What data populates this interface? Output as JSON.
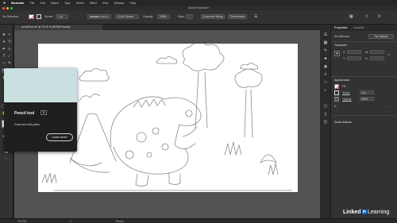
{
  "menubar": {
    "app_name": "Illustrator",
    "items": [
      "File",
      "Edit",
      "Object",
      "Type",
      "Select",
      "Effect",
      "View",
      "Window",
      "Help"
    ]
  },
  "window": {
    "title": "Adobe Illustrator"
  },
  "control_bar": {
    "selection_label": "No Selection",
    "stroke_label": "Stroke:",
    "stroke_value": "1 pt",
    "uniform_label": "Uniform",
    "brush_label": "5 pt. Round",
    "opacity_label": "Opacity:",
    "opacity_value": "100%",
    "style_label": "Style:",
    "document_setup_button": "Document Setup",
    "preferences_button": "Preferences"
  },
  "document_tab": {
    "label": "pencilTool.ai* @ 73.19 % (RGB/Preview)"
  },
  "tooltip": {
    "title": "Pencil tool",
    "shortcut": "N",
    "description": "Draw and edit paths",
    "learn_more_button": "Learn more"
  },
  "panel": {
    "tabs": [
      "Properties",
      "Libraries"
    ],
    "selection_state": "No Selection",
    "tool_options_button": "Tool Options",
    "transform_heading": "Transform",
    "transform_fields": {
      "x_label": "X:",
      "y_label": "Y:",
      "w_label": "W:",
      "h_label": "H:"
    },
    "appearance_heading": "Appearance",
    "fill_label": "Fill",
    "stroke_label": "Stroke",
    "stroke_value": "1 pt",
    "opacity_label": "Opacity",
    "opacity_value": "100%",
    "fx_label": "fx",
    "quick_actions_heading": "Quick Actions"
  },
  "status_bar": {
    "zoom": "73.19%",
    "artboard": "1",
    "tool_name": "Pencil"
  },
  "watermark": {
    "brand_a": "Linked",
    "brand_box": "in",
    "brand_b": "Learning"
  },
  "colors": {
    "accent": "#0a66c2",
    "tooltip_preview": "#c9dfe0",
    "ui_dark": "#323232"
  }
}
